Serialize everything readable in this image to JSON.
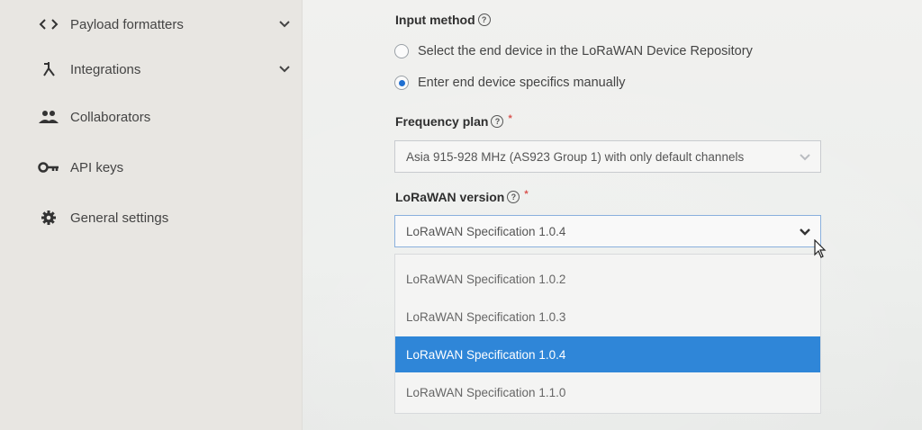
{
  "sidebar": {
    "items": [
      {
        "label": "Payload formatters",
        "icon": "code-brackets-icon",
        "has_chevron": true
      },
      {
        "label": "Integrations",
        "icon": "integrations-icon",
        "has_chevron": true
      },
      {
        "label": "Collaborators",
        "icon": "people-icon",
        "has_chevron": false
      },
      {
        "label": "API keys",
        "icon": "key-icon",
        "has_chevron": false
      },
      {
        "label": "General settings",
        "icon": "gear-icon",
        "has_chevron": false
      }
    ]
  },
  "form": {
    "input_method": {
      "label": "Input method",
      "options": [
        {
          "label": "Select the end device in the LoRaWAN Device Repository",
          "checked": false
        },
        {
          "label": "Enter end device specifics manually",
          "checked": true
        }
      ]
    },
    "frequency_plan": {
      "label": "Frequency plan",
      "required": true,
      "value": "Asia 915-928 MHz (AS923 Group 1) with only default channels"
    },
    "lorawan_version": {
      "label": "LoRaWAN version",
      "required": true,
      "value": "LoRaWAN Specification 1.0.4",
      "open": true,
      "options": [
        {
          "label": "LoRaWAN Specification 1.0.2",
          "selected": false
        },
        {
          "label": "LoRaWAN Specification 1.0.3",
          "selected": false
        },
        {
          "label": "LoRaWAN Specification 1.0.4",
          "selected": true
        },
        {
          "label": "LoRaWAN Specification 1.1.0",
          "selected": false
        }
      ]
    }
  },
  "colors": {
    "accent": "#2f86d8",
    "radio_checked": "#1f6fd1",
    "required": "#d9534f"
  }
}
